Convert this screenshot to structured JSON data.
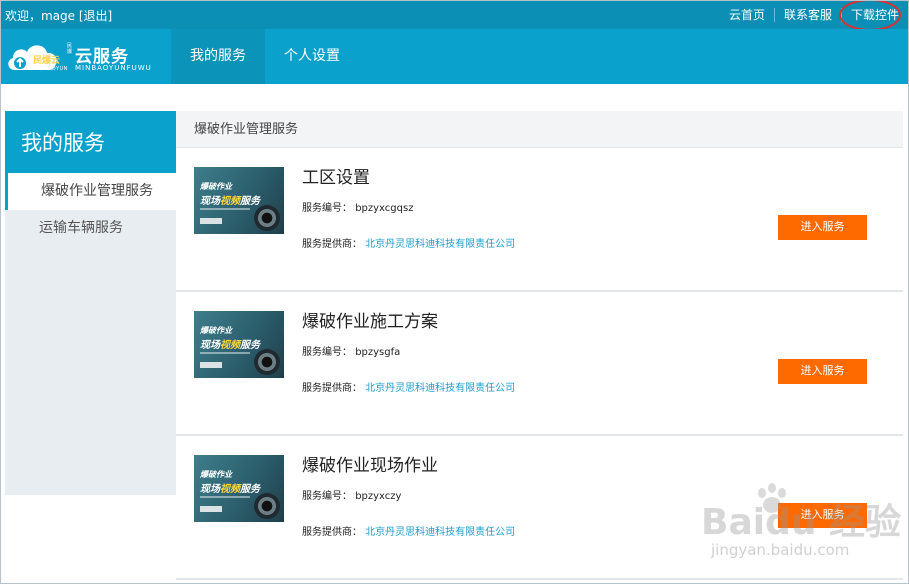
{
  "topbar": {
    "welcome": "欢迎，mage",
    "logout": "[退出]",
    "links": [
      "云首页",
      "联系客服",
      "下载控件"
    ]
  },
  "logo": {
    "brand": "云服务",
    "brand_en": "MINBAOYUNFUWU",
    "cloud_cn": "民爆云",
    "cloud_en": "MINBAOYUN",
    "tag": "民爆"
  },
  "nav": {
    "items": [
      {
        "label": "我的服务",
        "active": true
      },
      {
        "label": "个人设置",
        "active": false
      }
    ]
  },
  "sidebar": {
    "title": "我的服务",
    "items": [
      {
        "label": "爆破作业管理服务",
        "active": true
      },
      {
        "label": "运输车辆服务",
        "active": false
      }
    ]
  },
  "main": {
    "section_title": "爆破作业管理服务",
    "thumb": {
      "line1": "爆破作业",
      "line2a": "现场",
      "line2b": "视频",
      "line2c": "服务"
    },
    "cards": [
      {
        "title": "工区设置",
        "code_label": "服务编号：",
        "code": "bpzyxcgqsz",
        "provider_label": "服务提供商：",
        "provider": "北京丹灵思科迪科技有限责任公司",
        "button": "进入服务"
      },
      {
        "title": "爆破作业施工方案",
        "code_label": "服务编号：",
        "code": "bpzysgfa",
        "provider_label": "服务提供商：",
        "provider": "北京丹灵思科迪科技有限责任公司",
        "button": "进入服务"
      },
      {
        "title": "爆破作业现场作业",
        "code_label": "服务编号：",
        "code": "bpzyxczy",
        "provider_label": "服务提供商：",
        "provider": "北京丹灵思科迪科技有限责任公司",
        "button": "进入服务"
      }
    ]
  },
  "watermark": {
    "logo": "Baidu 经验",
    "url": "jingyan.baidu.com"
  },
  "colors": {
    "header": "#0aa2cc",
    "topbar": "#0b8fb5",
    "button": "#ff6a00",
    "link": "#1a9ccd",
    "highlight_ring": "#d9322e"
  }
}
